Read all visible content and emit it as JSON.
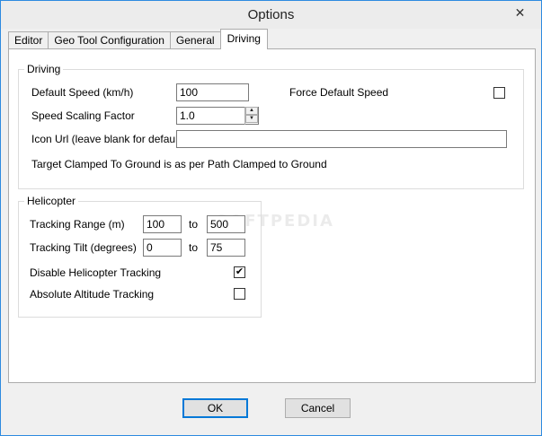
{
  "window": {
    "title": "Options",
    "close_glyph": "✕"
  },
  "tabs": [
    {
      "label": "Editor"
    },
    {
      "label": "Geo Tool Configuration"
    },
    {
      "label": "General"
    },
    {
      "label": "Driving"
    }
  ],
  "active_tab": "Driving",
  "driving": {
    "group_label": "Driving",
    "default_speed_label": "Default Speed (km/h)",
    "default_speed_value": "100",
    "force_default_speed_label": "Force Default Speed",
    "force_default_speed_checked": false,
    "speed_scaling_label": "Speed Scaling Factor",
    "speed_scaling_value": "1.0",
    "icon_url_label": "Icon Url (leave blank for default)",
    "icon_url_value": "",
    "info_text": "Target Clamped To Ground is as per Path Clamped to Ground"
  },
  "helicopter": {
    "group_label": "Helicopter",
    "tracking_range_label": "Tracking Range (m)",
    "tracking_range_from": "100",
    "tracking_range_to_label": "to",
    "tracking_range_to": "500",
    "tracking_tilt_label": "Tracking Tilt (degrees)",
    "tracking_tilt_from": "0",
    "tracking_tilt_to_label": "to",
    "tracking_tilt_to": "75",
    "disable_tracking_label": "Disable Helicopter Tracking",
    "disable_tracking_checked": true,
    "absolute_altitude_label": "Absolute Altitude Tracking",
    "absolute_altitude_checked": false
  },
  "buttons": {
    "ok_label": "OK",
    "cancel_label": "Cancel"
  },
  "watermark": "SOFTPEDIA",
  "icons": {
    "close": "close-icon",
    "spin_up": "chevron-up-icon",
    "spin_down": "chevron-down-icon",
    "check": "checkmark-icon"
  }
}
